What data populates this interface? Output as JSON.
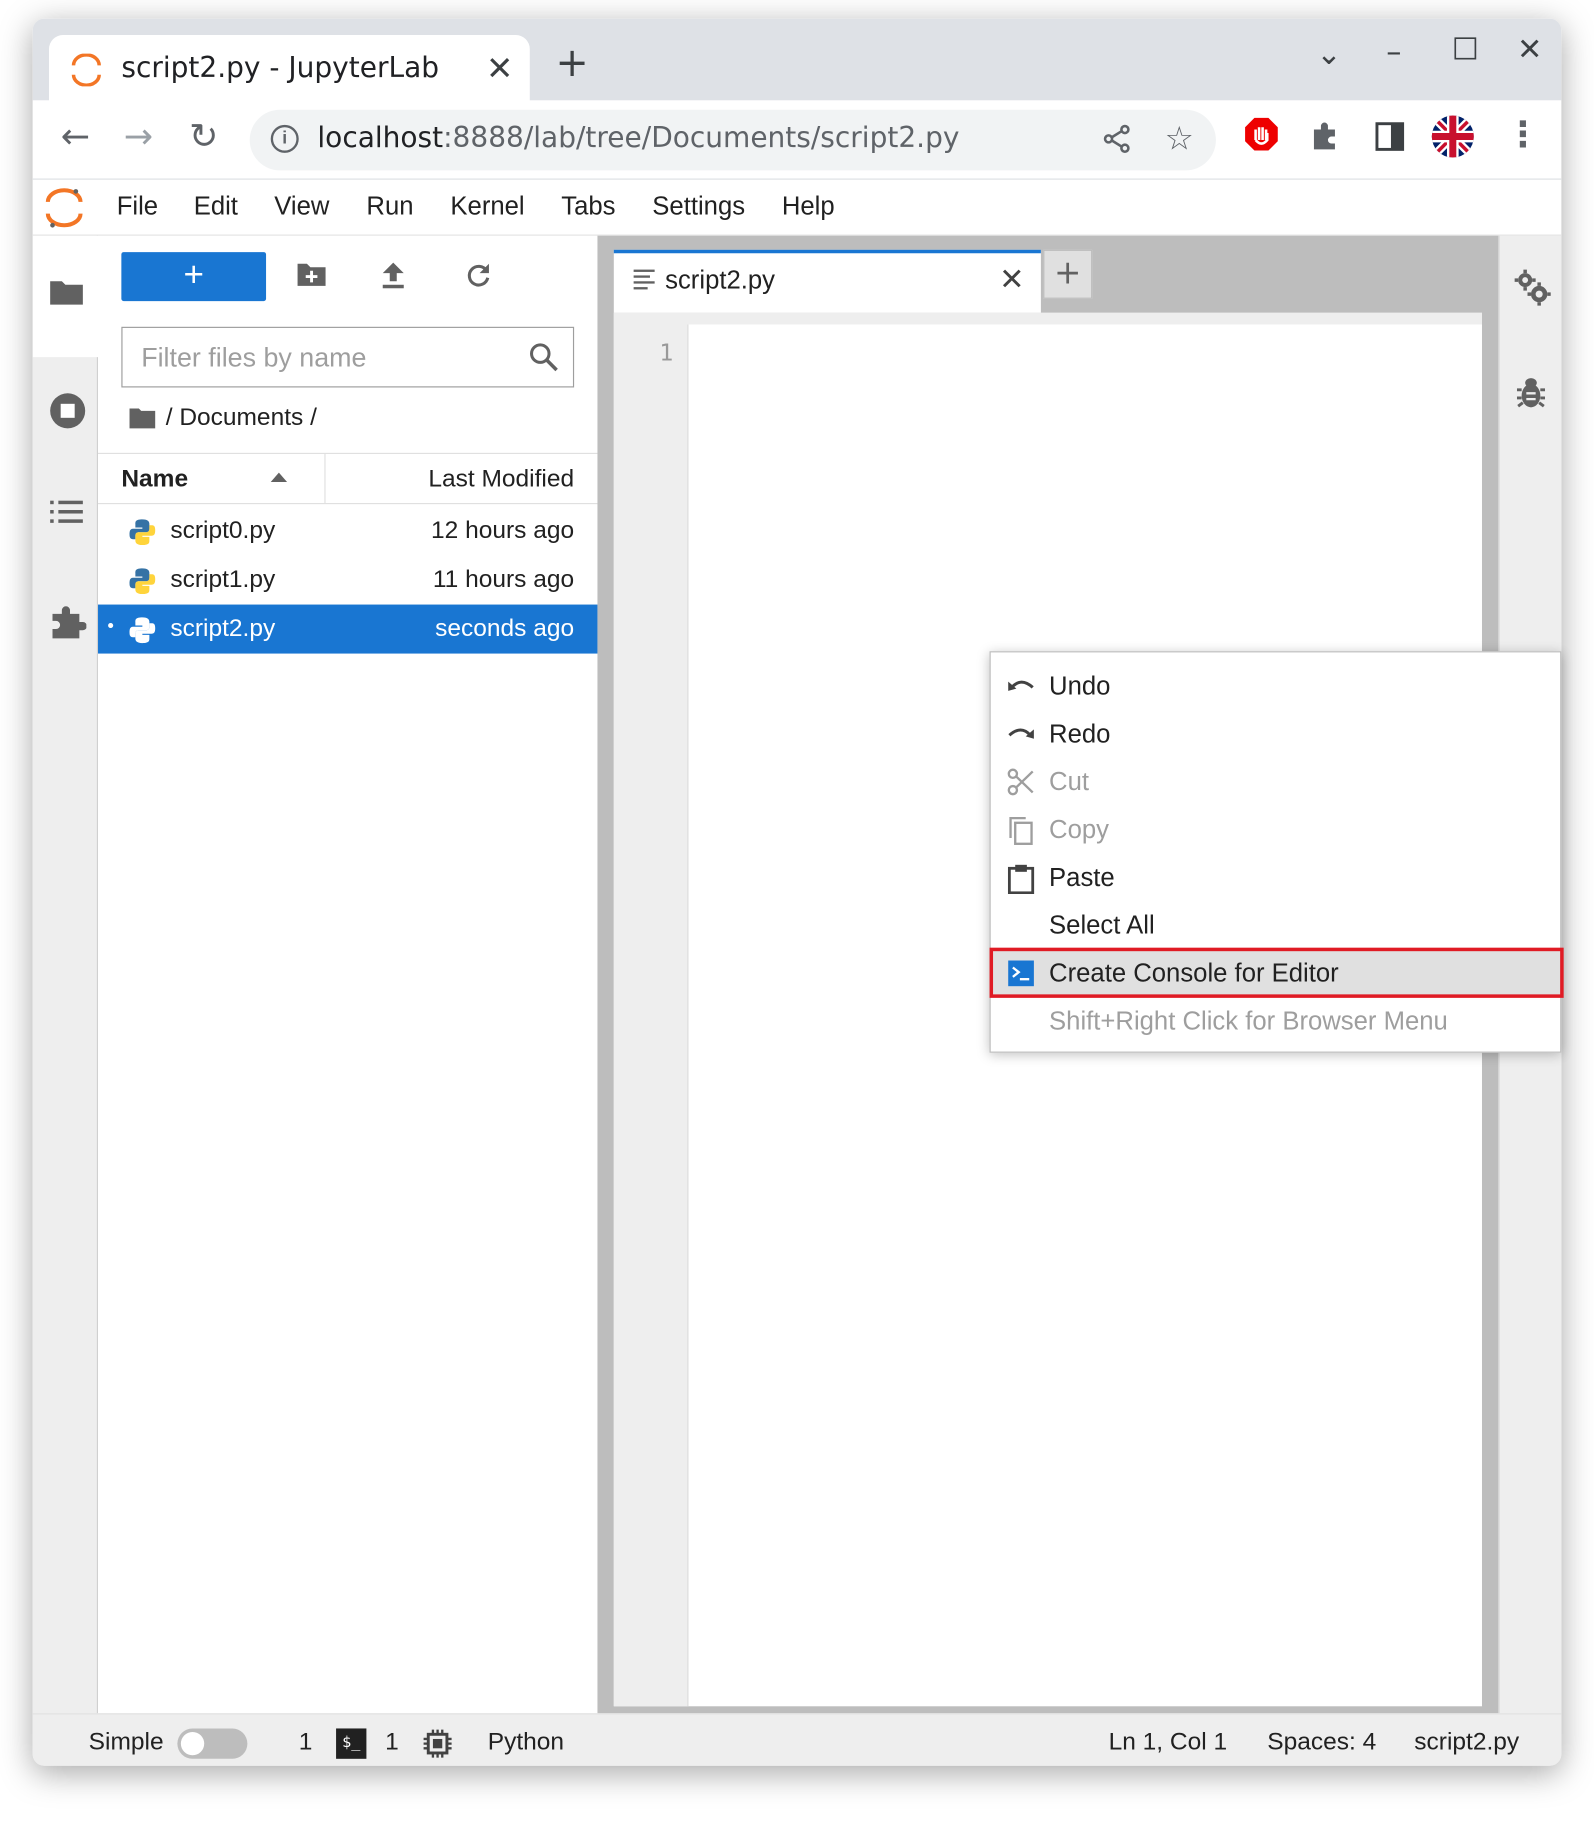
{
  "browser": {
    "tab_title": "script2.py - JupyterLab",
    "url_host": "localhost",
    "url_rest": ":8888/lab/tree/Documents/script2.py"
  },
  "menubar": {
    "items": [
      "File",
      "Edit",
      "View",
      "Run",
      "Kernel",
      "Tabs",
      "Settings",
      "Help"
    ]
  },
  "filebrowser": {
    "new_label": "+",
    "filter_placeholder": "Filter files by name",
    "breadcrumb": "/ Documents /",
    "columns": {
      "name": "Name",
      "modified": "Last Modified"
    },
    "files": [
      {
        "name": "script0.py",
        "modified": "12 hours ago",
        "selected": false
      },
      {
        "name": "script1.py",
        "modified": "11 hours ago",
        "selected": false
      },
      {
        "name": "script2.py",
        "modified": "seconds ago",
        "selected": true
      }
    ]
  },
  "editor": {
    "tab_label": "script2.py",
    "line_numbers": [
      "1"
    ]
  },
  "context_menu": {
    "items": [
      {
        "label": "Undo",
        "icon": "undo-icon",
        "enabled": true
      },
      {
        "label": "Redo",
        "icon": "redo-icon",
        "enabled": true
      },
      {
        "label": "Cut",
        "icon": "cut-icon",
        "enabled": false
      },
      {
        "label": "Copy",
        "icon": "copy-icon",
        "enabled": false
      },
      {
        "label": "Paste",
        "icon": "paste-icon",
        "enabled": true
      },
      {
        "label": "Select All",
        "icon": "",
        "enabled": true
      },
      {
        "label": "Create Console for Editor",
        "icon": "console-icon",
        "enabled": true,
        "highlighted": true
      },
      {
        "label": "Shift+Right Click for Browser Menu",
        "icon": "",
        "enabled": false
      }
    ]
  },
  "statusbar": {
    "mode_label": "Simple",
    "simple_mode_on": false,
    "kernels_count": "1",
    "terminal_badge": "$_",
    "terminals_count": "1",
    "language": "Python",
    "cursor": "Ln 1, Col 1",
    "indent": "Spaces: 4",
    "filename": "script2.py"
  },
  "colors": {
    "accent": "#1976d2",
    "highlight_border": "#e01b24",
    "jupyter_orange": "#f37626"
  }
}
